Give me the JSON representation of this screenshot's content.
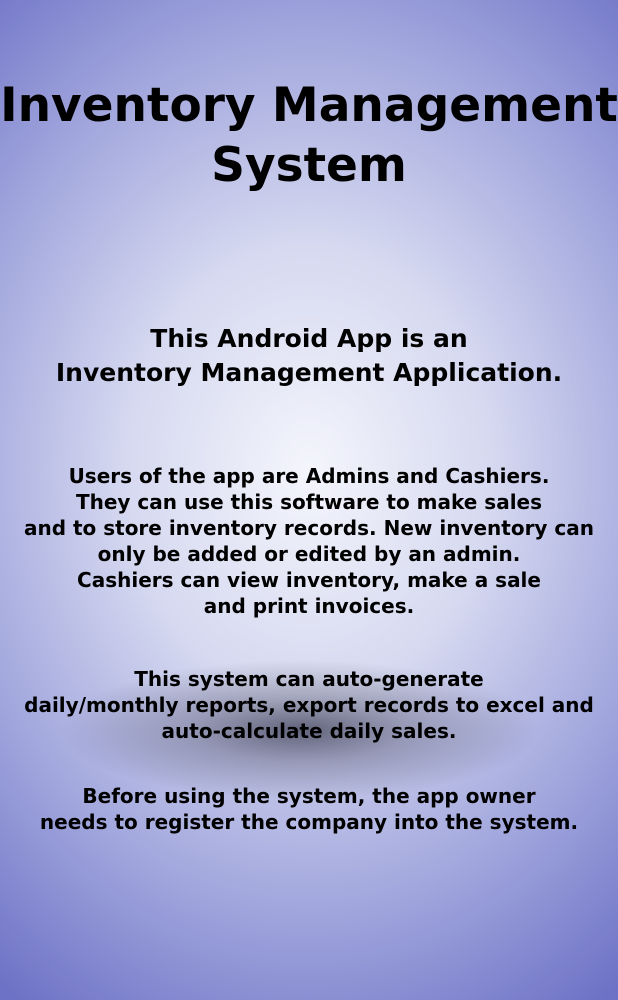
{
  "title": {
    "line1": "Inventory Management",
    "line2": "System"
  },
  "intro": {
    "line1": "This Android App is an",
    "line2": "Inventory Management Application."
  },
  "description": {
    "line1": "Users of the app are Admins and Cashiers.",
    "line2": "They can use this software to make sales",
    "line3": "and to store inventory records. New inventory can",
    "line4": "only be added or edited by an admin.",
    "line5": "Cashiers can view inventory, make a sale",
    "line6": "and print invoices."
  },
  "features": {
    "line1": "This system can auto-generate",
    "line2": "daily/monthly reports, export records to excel and",
    "line3": "auto-calculate daily sales."
  },
  "setup_note": {
    "line1": "Before using the system, the app owner",
    "line2": "needs to register the company into the system."
  }
}
